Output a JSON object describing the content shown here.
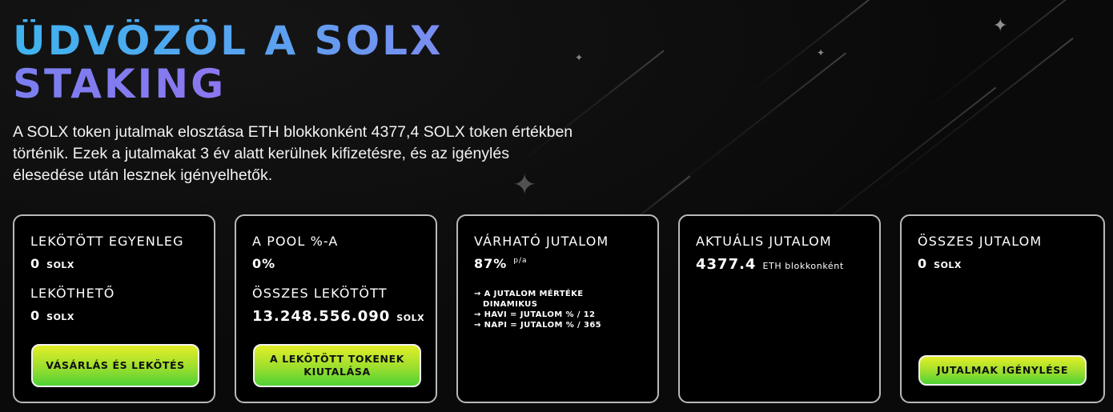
{
  "title": {
    "line1": "Üdvözöl a SOLX",
    "line2": "Staking"
  },
  "description": "A SOLX token jutalmak elosztása ETH blokkonként 4377,4 SOLX token értékben történik. Ezek a jutalmakat 3 év alatt kerülnek kifizetésre, és az igénylés élesedése után lesznek igényelhetők.",
  "cards": {
    "staked_balance": {
      "label": "Lekötött egyenleg",
      "value": "0",
      "unit": "SOLX",
      "available_label": "Leköthető",
      "available_value": "0",
      "available_unit": "SOLX",
      "button": "Vásárlás és lekötés"
    },
    "pool_share": {
      "label": "A pool %-a",
      "value": "0%",
      "total_label": "Összes lekötött",
      "total_value": "13.248.556.090",
      "total_unit": "SOLX",
      "button": "A lekötött tokenek kiutalása"
    },
    "expected_reward": {
      "label": "Várható jutalom",
      "value": "87%",
      "unit": "p/a",
      "note1_a": "→ A jutalom mértéke",
      "note1_b": "dinamikus",
      "note2": "→ Havi = jutalom % / 12",
      "note3": "→ Napi = jutalom % / 365"
    },
    "current_reward": {
      "label": "Aktuális jutalom",
      "value": "4377.4",
      "unit": "ETH blokkonként"
    },
    "total_reward": {
      "label": "Összes jutalom",
      "value": "0",
      "unit": "SOLX",
      "button": "Jutalmak igénylése"
    }
  },
  "colors": {
    "title_gradient_start": "#3fb3ef",
    "title_gradient_end": "#9a6ff0",
    "button_gradient_top": "#e3ef27",
    "button_gradient_bottom": "#4fd235",
    "card_border": "#b9b9b9",
    "background": "#0b0b0b"
  }
}
